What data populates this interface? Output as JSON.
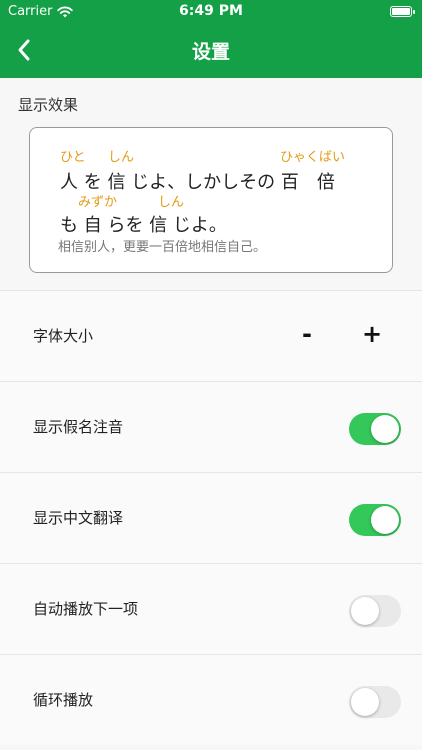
{
  "status_bar": {
    "carrier": "Carrier",
    "time": "6:49 PM"
  },
  "nav": {
    "title": "设置",
    "back_icon": "chevron-left-icon"
  },
  "preview": {
    "section_label": "显示效果",
    "line1": "人 を 信 じよ、しかしその 百　倍",
    "line2": "も 自 らを 信 じよ。",
    "ruby_hito": "ひと",
    "ruby_shin1": "しん",
    "ruby_hyakubai": "ひゃくばい",
    "ruby_mizuka": "みずか",
    "ruby_shin2": "しん",
    "translation": "相信别人，更要一百倍地相信自己。"
  },
  "settings": {
    "font_size": {
      "label": "字体大小",
      "minus": "-",
      "plus": "+"
    },
    "show_kana": {
      "label": "显示假名注音",
      "value": true
    },
    "show_chinese": {
      "label": "显示中文翻译",
      "value": true
    },
    "autoplay_next": {
      "label": "自动播放下一项",
      "value": false
    },
    "loop_play": {
      "label": "循环播放",
      "value": false
    }
  },
  "colors": {
    "brand": "#13a046",
    "toggle_on": "#34c759",
    "toggle_off": "#e9e9ea",
    "ruby": "#e59a12"
  }
}
